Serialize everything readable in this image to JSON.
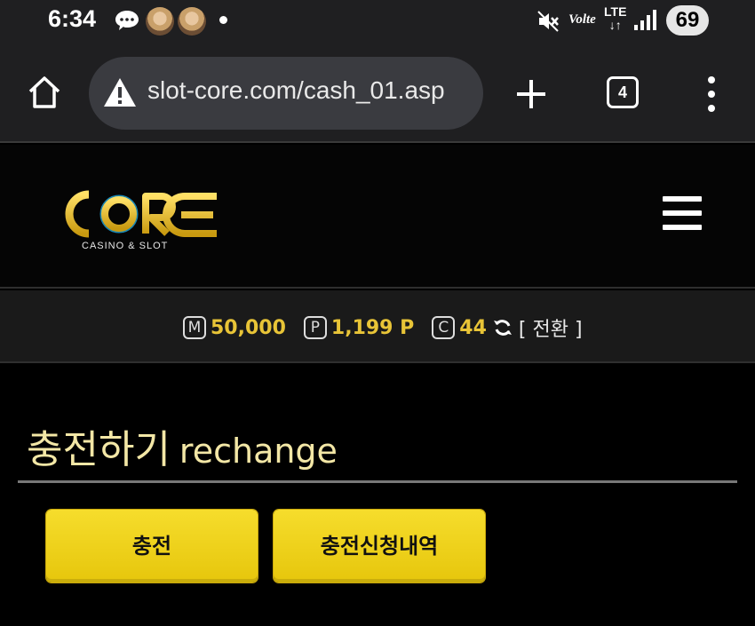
{
  "status_bar": {
    "time": "6:34",
    "network_label": "Volte",
    "network_type": "LTE",
    "battery": "69",
    "icons": [
      "chat-bubble-icon",
      "avatar-icon",
      "avatar-icon",
      "notification-dot-icon",
      "mute-icon",
      "signal-icon"
    ]
  },
  "browser": {
    "url": "slot-core.com/cash_01.asp",
    "tab_count": "4",
    "icons": [
      "home-icon",
      "warning-icon",
      "plus-icon",
      "more-icon"
    ]
  },
  "site": {
    "logo_text": "CORE",
    "logo_subtext": "CASINO & SLOT",
    "menu_icon": "hamburger-icon"
  },
  "balance": {
    "money_badge": "M",
    "money": "50,000",
    "point_badge": "P",
    "points": "1,199 P",
    "coin_badge": "C",
    "coins": "44",
    "switch_label": "[ 전환 ]"
  },
  "page": {
    "title_ko": "충전하기",
    "title_en": "rechange"
  },
  "buttons": {
    "charge": "충전",
    "history": "충전신청내역"
  },
  "colors": {
    "accent_yellow": "#e8c437",
    "button_yellow": "#f2d31e",
    "title_color": "#f3e7a6"
  }
}
